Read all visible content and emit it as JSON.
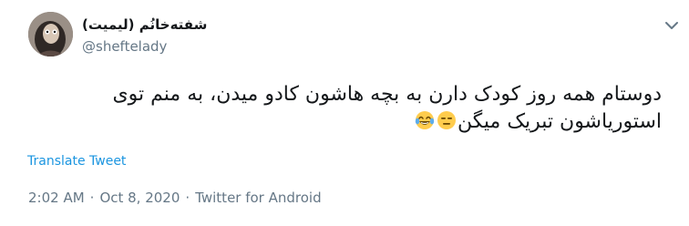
{
  "tweet": {
    "display_name": "شفته‌خانُم (لیمیت)",
    "handle": "@sheftelady",
    "text_line_1": "دوستام همه روز کودک دارن به بچه هاشون کادو میدن، به منم توی",
    "text_line_2": "استوریاشون تبریک میگن",
    "emojis": [
      "expressionless-face",
      "face-with-tears-of-joy"
    ],
    "translate_label": "Translate Tweet",
    "time": "2:02 AM",
    "date": "Oct 8, 2020",
    "source": "Twitter for Android",
    "separator": "·"
  },
  "colors": {
    "text": "#14171a",
    "secondary": "#657786",
    "link": "#1b95e0",
    "emoji_yellow": "#ffcc4d"
  }
}
